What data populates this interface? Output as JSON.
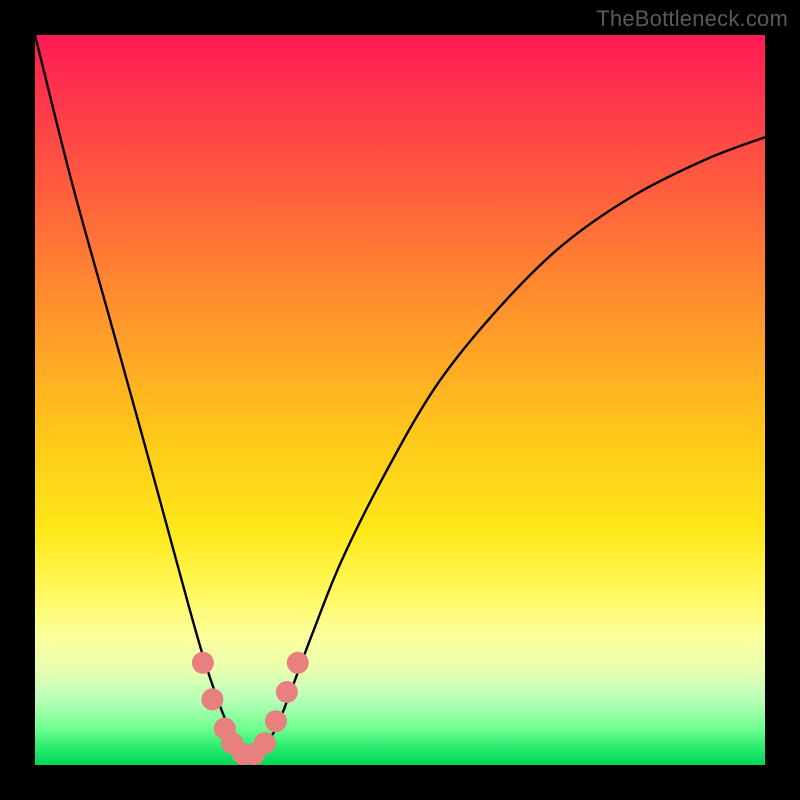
{
  "watermark": "TheBottleneck.com",
  "chart_data": {
    "type": "line",
    "title": "",
    "xlabel": "",
    "ylabel": "",
    "xlim": [
      0,
      100
    ],
    "ylim": [
      0,
      100
    ],
    "grid": false,
    "legend": false,
    "series": [
      {
        "name": "bottleneck-curve",
        "x": [
          0,
          5,
          10,
          15,
          18,
          21,
          23,
          25,
          27,
          28,
          29,
          30,
          31,
          33,
          35,
          38,
          42,
          48,
          55,
          63,
          72,
          82,
          92,
          100
        ],
        "y": [
          100,
          80,
          62,
          44,
          33,
          22,
          15,
          9,
          4,
          2,
          1,
          1,
          2,
          5,
          10,
          18,
          28,
          40,
          52,
          62,
          71,
          78,
          83,
          86
        ]
      }
    ],
    "markers": [
      {
        "name": "left-dot-1",
        "x": 23.0,
        "y": 14.0
      },
      {
        "name": "left-dot-2",
        "x": 24.3,
        "y": 9.0
      },
      {
        "name": "left-dot-3",
        "x": 26.0,
        "y": 5.0
      },
      {
        "name": "trough-1",
        "x": 27.0,
        "y": 3.0
      },
      {
        "name": "trough-2",
        "x": 28.5,
        "y": 1.5
      },
      {
        "name": "trough-3",
        "x": 30.0,
        "y": 1.5
      },
      {
        "name": "trough-4",
        "x": 31.5,
        "y": 3.0
      },
      {
        "name": "right-dot-1",
        "x": 33.0,
        "y": 6.0
      },
      {
        "name": "right-dot-2",
        "x": 34.5,
        "y": 10.0
      },
      {
        "name": "right-dot-3",
        "x": 36.0,
        "y": 14.0
      }
    ],
    "marker_color": "#e88080",
    "curve_color": "#000000"
  }
}
